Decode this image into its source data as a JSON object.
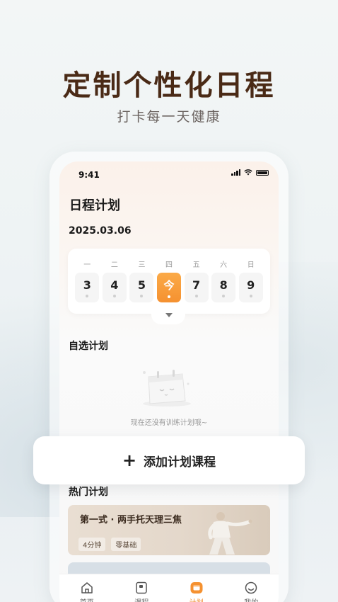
{
  "promo": {
    "headline": "定制个性化日程",
    "subheadline": "打卡每一天健康"
  },
  "status_bar": {
    "time": "9:41"
  },
  "screen": {
    "title": "日程计划",
    "date": "2025.03.06"
  },
  "week": {
    "labels": [
      "一",
      "二",
      "三",
      "四",
      "五",
      "六",
      "日"
    ],
    "days": [
      "3",
      "4",
      "5",
      "今",
      "7",
      "8",
      "9"
    ],
    "today_index": 3
  },
  "custom_plans": {
    "title": "自选计划",
    "empty_text": "现在还没有训练计划哦~"
  },
  "add_plan": {
    "icon": "plus-icon",
    "label": "添加计划课程"
  },
  "hot_plans": {
    "title": "热门计划",
    "items": [
      {
        "title": "第一式 · 两手托天理三焦",
        "tags": [
          "4分钟",
          "零基础"
        ]
      }
    ]
  },
  "tabbar": {
    "items": [
      {
        "label": "首页",
        "icon": "home-icon"
      },
      {
        "label": "课程",
        "icon": "course-icon"
      },
      {
        "label": "计划",
        "icon": "plan-icon",
        "active": true
      },
      {
        "label": "我的",
        "icon": "profile-icon"
      }
    ]
  },
  "colors": {
    "accent": "#f59130",
    "headline": "#4a2a16"
  }
}
